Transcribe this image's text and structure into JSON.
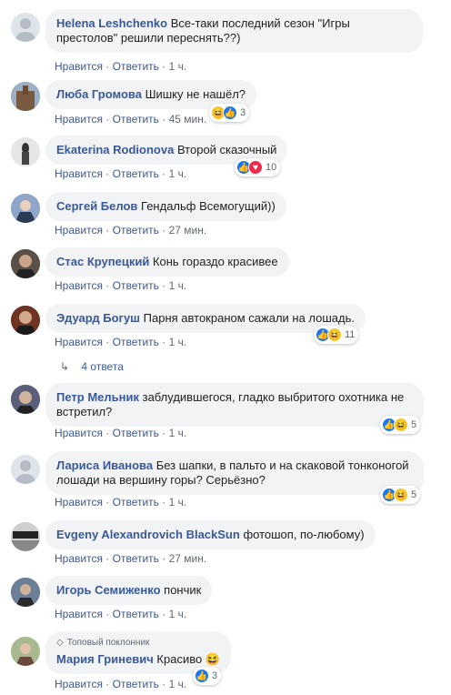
{
  "actions": {
    "like": "Нравится",
    "reply": "Ответить",
    "sep": "·"
  },
  "comments": [
    {
      "name": "Helena Leshchenko",
      "text": "Все-таки последний сезон \"Игры престолов\" решили переснять??)",
      "time": "1 ч."
    },
    {
      "name": "Люба Громова",
      "text": "Шишку не нашёл?",
      "time": "45 мин.",
      "reaction_count": "3"
    },
    {
      "name": "Ekaterina Rodionova",
      "text": "Второй сказочный",
      "time": "1 ч.",
      "reaction_count": "10"
    },
    {
      "name": "Сергей Белов",
      "text": "Гендальф Всемогущий))",
      "time": "27 мин."
    },
    {
      "name": "Стас Крупецкий",
      "text": "Конь гораздо красивее",
      "time": "1 ч."
    },
    {
      "name": "Эдуард Богуш",
      "text": "Парня автокраном сажали на лошадь.",
      "time": "1 ч.",
      "reaction_count": "11"
    },
    {
      "name": "Петр Мельник",
      "text": "заблудившегося, гладко выбритого охотника не встретил?",
      "time": "1 ч.",
      "reaction_count": "5"
    },
    {
      "name": "Лариса Иванова",
      "text": "Без шапки, в пальто и на скаковой тонконогой лошади на вершину горы? Серьёзно?",
      "time": "1 ч.",
      "reaction_count": "5"
    },
    {
      "name": "Evgeny Alexandrovich BlackSun",
      "text": "фотошоп, по-любому)",
      "time": "27 мин."
    },
    {
      "name": "Игорь Семиженко",
      "text": "пончик",
      "time": "1 ч."
    },
    {
      "name": "Мария Гриневич",
      "text": "Красиво",
      "time": "1 ч.",
      "reaction_count": "3",
      "badge": "Топовый поклонник"
    }
  ],
  "replies_link": "4 ответа",
  "colors": {
    "link": "#385898",
    "bubble": "#f2f3f5",
    "meta": "#606770"
  }
}
